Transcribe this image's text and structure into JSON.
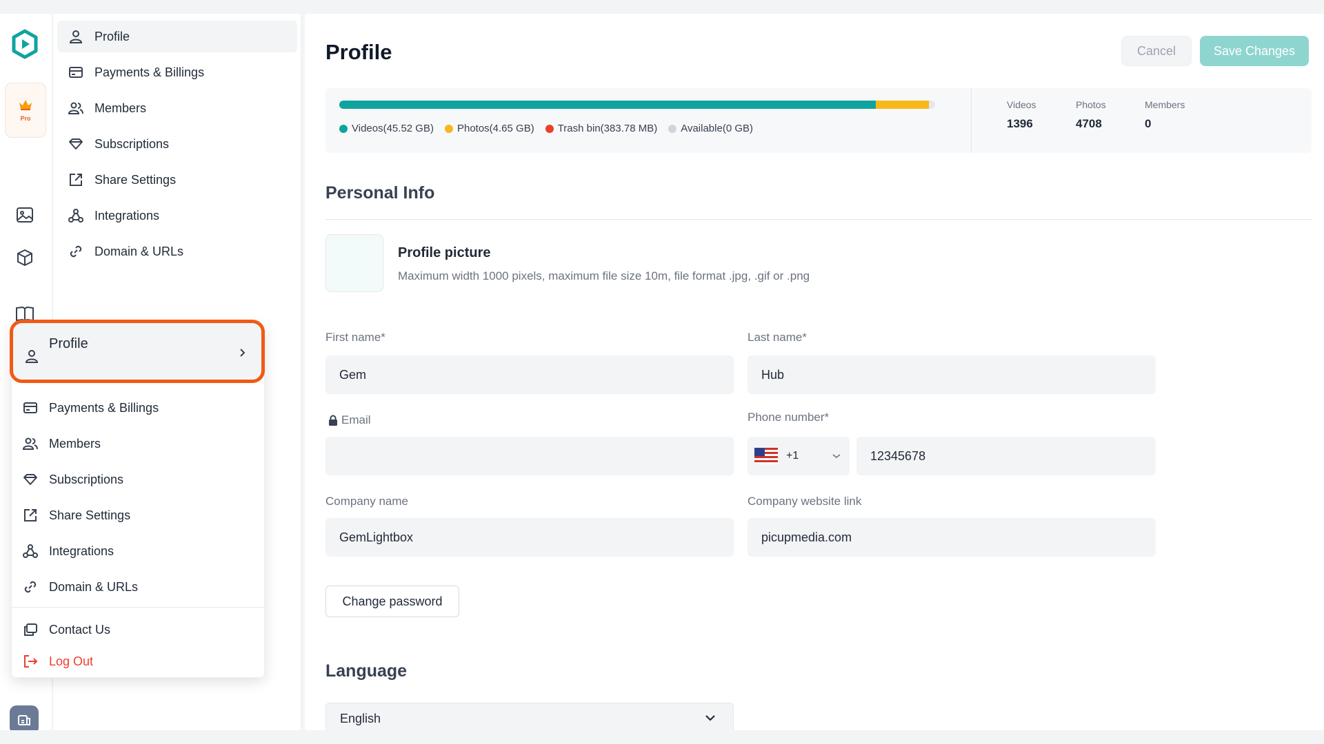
{
  "colors": {
    "accent": "#0fa3a0",
    "orange": "#f15a14",
    "photos": "#f6b81a",
    "trash": "#ef3d2f",
    "available": "#d1d5db",
    "save_bg": "#8fd5cf"
  },
  "rail": {
    "pro_label": "Pro"
  },
  "nav": {
    "items": [
      {
        "label": "Profile",
        "icon": "user-icon"
      },
      {
        "label": "Payments & Billings",
        "icon": "card-icon"
      },
      {
        "label": "Members",
        "icon": "users-icon"
      },
      {
        "label": "Subscriptions",
        "icon": "diamond-icon"
      },
      {
        "label": "Share Settings",
        "icon": "share-icon"
      },
      {
        "label": "Integrations",
        "icon": "integrations-icon"
      },
      {
        "label": "Domain & URLs",
        "icon": "link-icon"
      }
    ]
  },
  "dropdown": {
    "header_label": "Profile",
    "items": [
      {
        "label": "Payments & Billings",
        "icon": "card-icon"
      },
      {
        "label": "Members",
        "icon": "users-icon"
      },
      {
        "label": "Subscriptions",
        "icon": "diamond-icon"
      },
      {
        "label": "Share Settings",
        "icon": "share-icon"
      },
      {
        "label": "Integrations",
        "icon": "integrations-icon"
      },
      {
        "label": "Domain & URLs",
        "icon": "link-icon"
      }
    ],
    "contact_label": "Contact Us",
    "logout_label": "Log Out"
  },
  "main": {
    "title": "Profile",
    "cancel_label": "Cancel",
    "save_label": "Save Changes",
    "storage": {
      "segments": [
        {
          "label": "Videos(45.52 GB)",
          "fraction": 0.9,
          "color": "#0fa3a0"
        },
        {
          "label": "Photos(4.65 GB)",
          "fraction": 0.09,
          "color": "#f6b81a"
        },
        {
          "label": "Trash bin(383.78 MB)",
          "fraction": 0.0,
          "color": "#ef3d2f"
        },
        {
          "label": "Available(0 GB)",
          "fraction": 0.0,
          "color": "#d1d5db"
        }
      ],
      "stats": [
        {
          "label": "Videos",
          "value": "1396"
        },
        {
          "label": "Photos",
          "value": "4708"
        },
        {
          "label": "Members",
          "value": "0"
        }
      ]
    },
    "personal_info_title": "Personal Info",
    "profile_picture_title": "Profile picture",
    "profile_picture_desc": "Maximum width 1000 pixels, maximum file size 10m, file format .jpg, .gif or .png",
    "first_name_label": "First name*",
    "first_name_value": "Gem",
    "last_name_label": "Last name*",
    "last_name_value": "Hub",
    "email_label": "Email",
    "email_value": "",
    "phone_label": "Phone number*",
    "phone_code": "+1",
    "phone_value": "12345678",
    "company_label": "Company name",
    "company_value": "GemLightbox",
    "website_label": "Company website link",
    "website_value": "picupmedia.com",
    "change_password_label": "Change password",
    "language_title": "Language",
    "language_value": "English"
  }
}
